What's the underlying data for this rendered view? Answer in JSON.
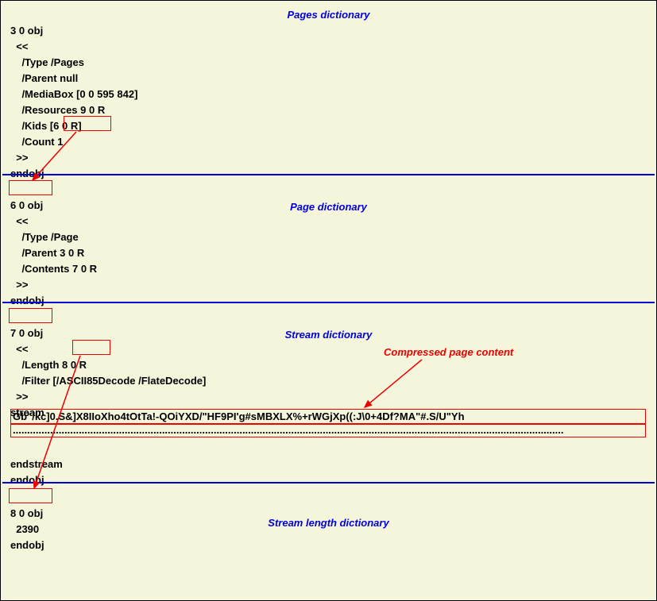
{
  "sections": {
    "pages": {
      "title": "Pages dictionary",
      "lines": [
        "3 0 obj",
        "  <<",
        "    /Type /Pages",
        "    /Parent null",
        "    /MediaBox [0 0 595 842]",
        "    /Resources 9 0 R",
        "    /Kids [6 0 R]",
        "    /Count 1",
        "  >>",
        "endobj"
      ]
    },
    "page": {
      "title": "Page dictionary",
      "lines": [
        "6 0 obj",
        "  <<",
        "    /Type /Page",
        "    /Parent 3 0 R",
        "    /Contents 7 0 R",
        "  >>",
        "endobj"
      ]
    },
    "stream": {
      "title": "Stream dictionary",
      "lines": [
        "7 0 obj",
        "  <<",
        "    /Length 8 0 R",
        "    /Filter [/ASCII85Decode /FlateDecode]",
        "  >>",
        "stream"
      ],
      "content_line": "Gb\"/kc]0.S&]X8IIoXho4tOtTa!-QOiYXD/\"HF9PI'g#sMBXLX%+rWGjXp((:J\\0+4Df?MA\"#.S/U\"Yh",
      "dots": "................................................................................................................................................................................................",
      "end_lines": [
        "endstream",
        "endobj"
      ]
    },
    "length": {
      "title": "Stream length dictionary",
      "lines": [
        "8 0 obj",
        "  2390",
        "endobj"
      ]
    }
  },
  "annotations": {
    "compressed": "Compressed page content"
  }
}
